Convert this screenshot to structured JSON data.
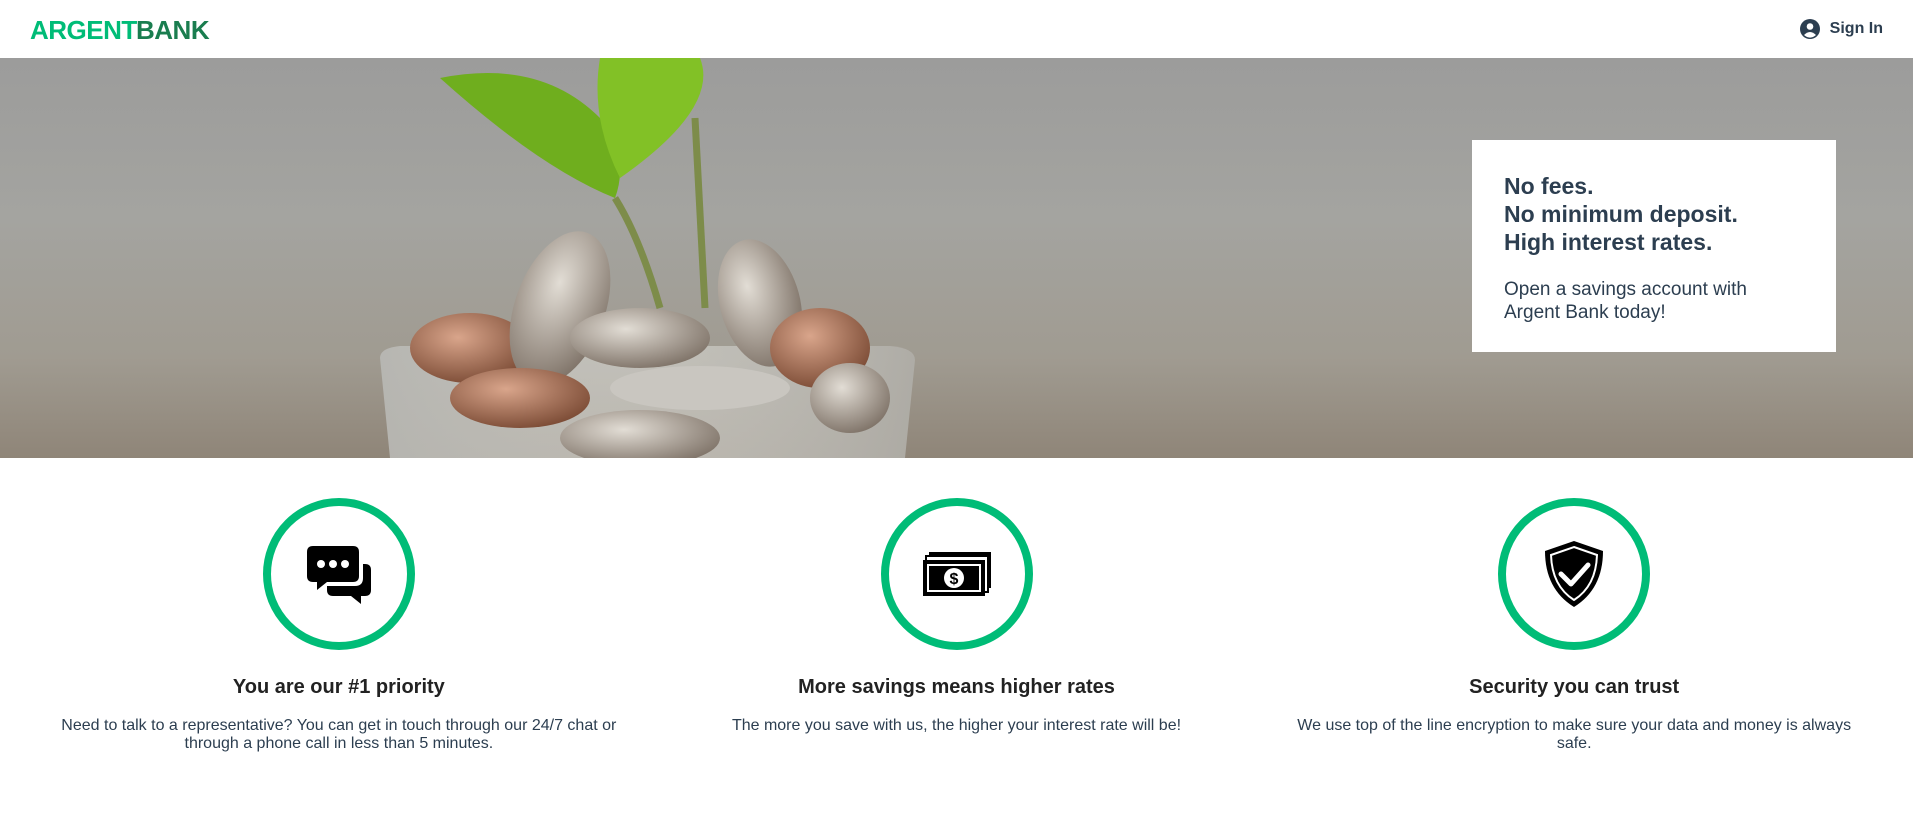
{
  "nav": {
    "logo_part1": "ARGENT",
    "logo_part2": "BANK",
    "signin_label": "Sign In"
  },
  "hero": {
    "subtitles": [
      "No fees.",
      "No minimum deposit.",
      "High interest rates."
    ],
    "text": "Open a savings account with Argent Bank today!"
  },
  "features": [
    {
      "icon": "chat-icon",
      "title": "You are our #1 priority",
      "text": "Need to talk to a representative? You can get in touch through our 24/7 chat or through a phone call in less than 5 minutes."
    },
    {
      "icon": "money-icon",
      "title": "More savings means higher rates",
      "text": "The more you save with us, the higher your interest rate will be!"
    },
    {
      "icon": "security-icon",
      "title": "Security you can trust",
      "text": "We use top of the line encryption to make sure your data and money is always safe."
    }
  ],
  "colors": {
    "accent": "#00bc77",
    "brand_dark": "#2c3e50",
    "logo_light": "#00bc77",
    "logo_dark": "#1a7d4f"
  }
}
